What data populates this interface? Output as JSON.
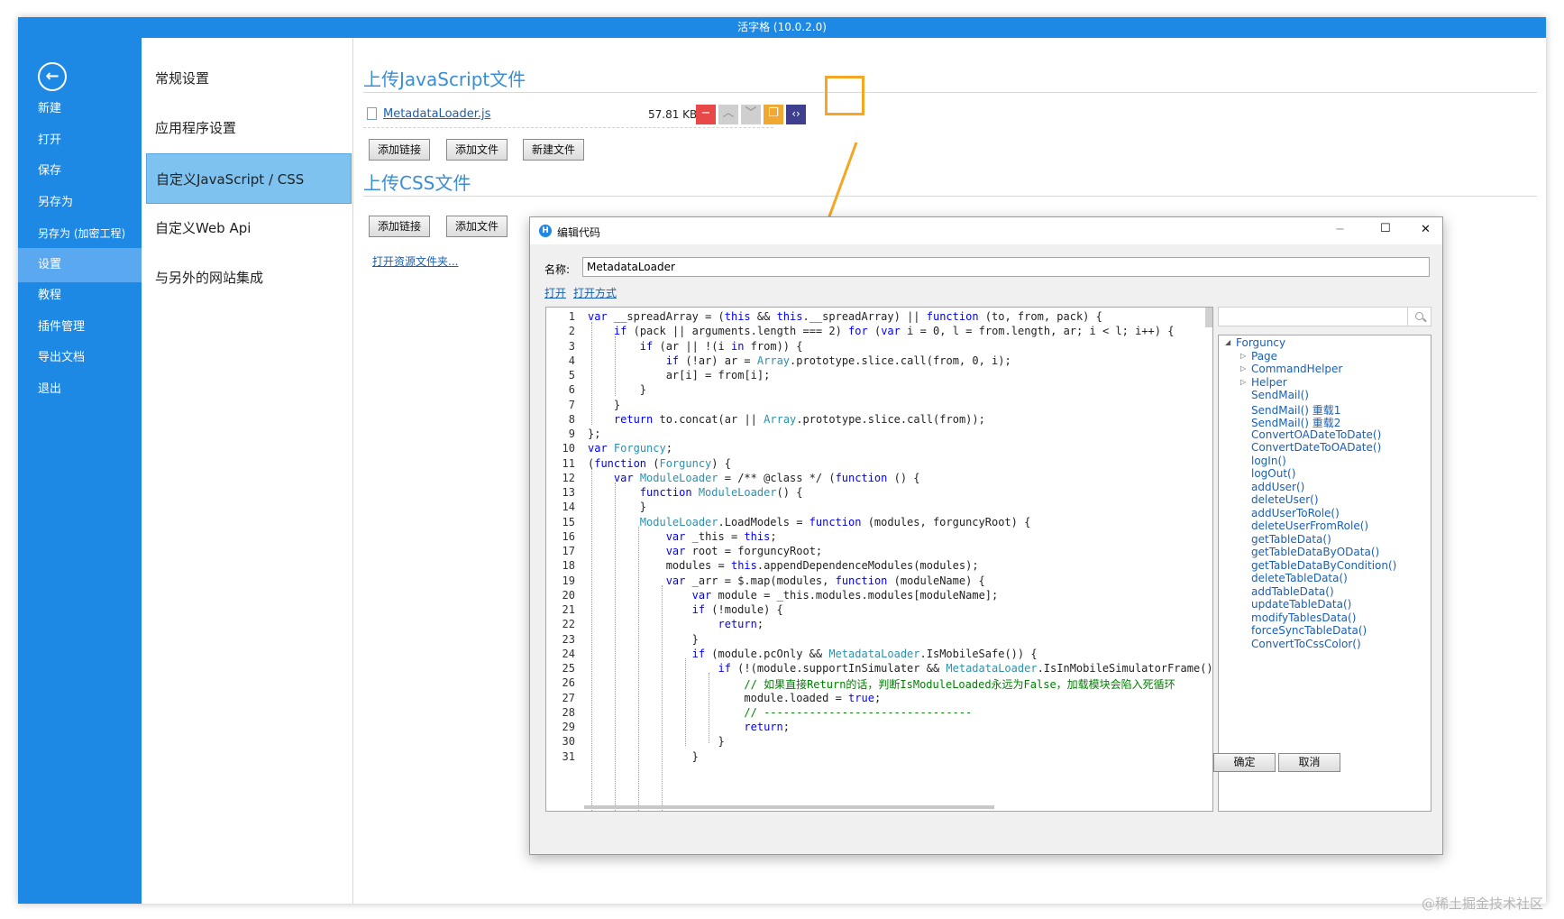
{
  "window": {
    "title": "活字格 (10.0.2.0)"
  },
  "leftnav": {
    "back_icon": "arrow-left-circle-icon",
    "items": [
      "新建",
      "打开",
      "保存",
      "另存为",
      "另存为 (加密工程)",
      "设置",
      "教程",
      "插件管理",
      "导出文档",
      "退出"
    ],
    "active_index": 5
  },
  "categories": {
    "items": [
      "常规设置",
      "应用程序设置",
      "自定义JavaScript / CSS",
      "自定义Web Api",
      "与另外的网站集成"
    ],
    "active_index": 2
  },
  "js_section": {
    "title": "上传JavaScript文件",
    "file": {
      "name": "MetadataLoader.js",
      "size": "57.81 KB",
      "icon": "file-icon"
    },
    "buttons": {
      "add_link": "添加链接",
      "add_file": "添加文件",
      "new_file": "新建文件"
    },
    "action_icons": [
      "minus-icon",
      "chevron-up-icon",
      "chevron-down-icon",
      "copy-icon",
      "code-icon"
    ],
    "action_glyphs": [
      "−",
      "︿",
      "﹀",
      "❐",
      "‹›"
    ],
    "colors": {
      "remove": "#e84848",
      "move": "#cfcfcf",
      "copy": "#f0a830",
      "edit": "#3f3f8f",
      "highlight": "#f5a623"
    }
  },
  "css_section": {
    "title": "上传CSS文件",
    "buttons": {
      "add_link": "添加链接",
      "add_file": "添加文件"
    },
    "open_folder_link": "打开资源文件夹..."
  },
  "dialog": {
    "title": "编辑代码",
    "title_icon": "H",
    "window_controls": {
      "minimize": "−",
      "maximize": "☐",
      "close": "✕"
    },
    "name_label": "名称:",
    "name_value": "MetadataLoader",
    "links": [
      "打开",
      "打开方式"
    ],
    "search_icon": "search-icon",
    "ok_label": "确定",
    "cancel_label": "取消",
    "code_lines": [
      "var __spreadArray = (this && this.__spreadArray) || function (to, from, pack) {",
      "    if (pack || arguments.length === 2) for (var i = 0, l = from.length, ar; i < l; i++) {",
      "        if (ar || !(i in from)) {",
      "            if (!ar) ar = Array.prototype.slice.call(from, 0, i);",
      "            ar[i] = from[i];",
      "        }",
      "    }",
      "    return to.concat(ar || Array.prototype.slice.call(from));",
      "};",
      "var Forguncy;",
      "(function (Forguncy) {",
      "    var ModuleLoader = /** @class */ (function () {",
      "        function ModuleLoader() {",
      "        }",
      "        ModuleLoader.LoadModels = function (modules, forguncyRoot) {",
      "            var _this = this;",
      "            var root = forguncyRoot;",
      "            modules = this.appendDependenceModules(modules);",
      "            var _arr = $.map(modules, function (moduleName) {",
      "                var module = _this.modules.modules[moduleName];",
      "                if (!module) {",
      "                    return;",
      "                }",
      "                if (module.pcOnly && MetadataLoader.IsMobileSafe()) {",
      "                    if (!(module.supportInSimulater && MetadataLoader.IsInMobileSimulatorFrame()))",
      "                        // 如果直接Return的话，判断IsModuleLoaded永远为False，加载模块会陷入死循环",
      "                        module.loaded = true;",
      "                        // --------------------------------",
      "                        return;",
      "                    }",
      "                }"
    ],
    "tree": {
      "root": "Forguncy",
      "children": [
        "Page",
        "CommandHelper",
        "Helper"
      ],
      "methods": [
        "SendMail()",
        "SendMail() 重载1",
        "SendMail() 重载2",
        "ConvertOADateToDate()",
        "ConvertDateToOADate()",
        "logIn()",
        "logOut()",
        "addUser()",
        "deleteUser()",
        "addUserToRole()",
        "deleteUserFromRole()",
        "getTableData()",
        "getTableDataByOData()",
        "getTableDataByCondition()",
        "deleteTableData()",
        "addTableData()",
        "updateTableData()",
        "modifyTablesData()",
        "forceSyncTableData()",
        "ConvertToCssColor()"
      ]
    }
  },
  "watermark": "@稀土掘金技术社区"
}
